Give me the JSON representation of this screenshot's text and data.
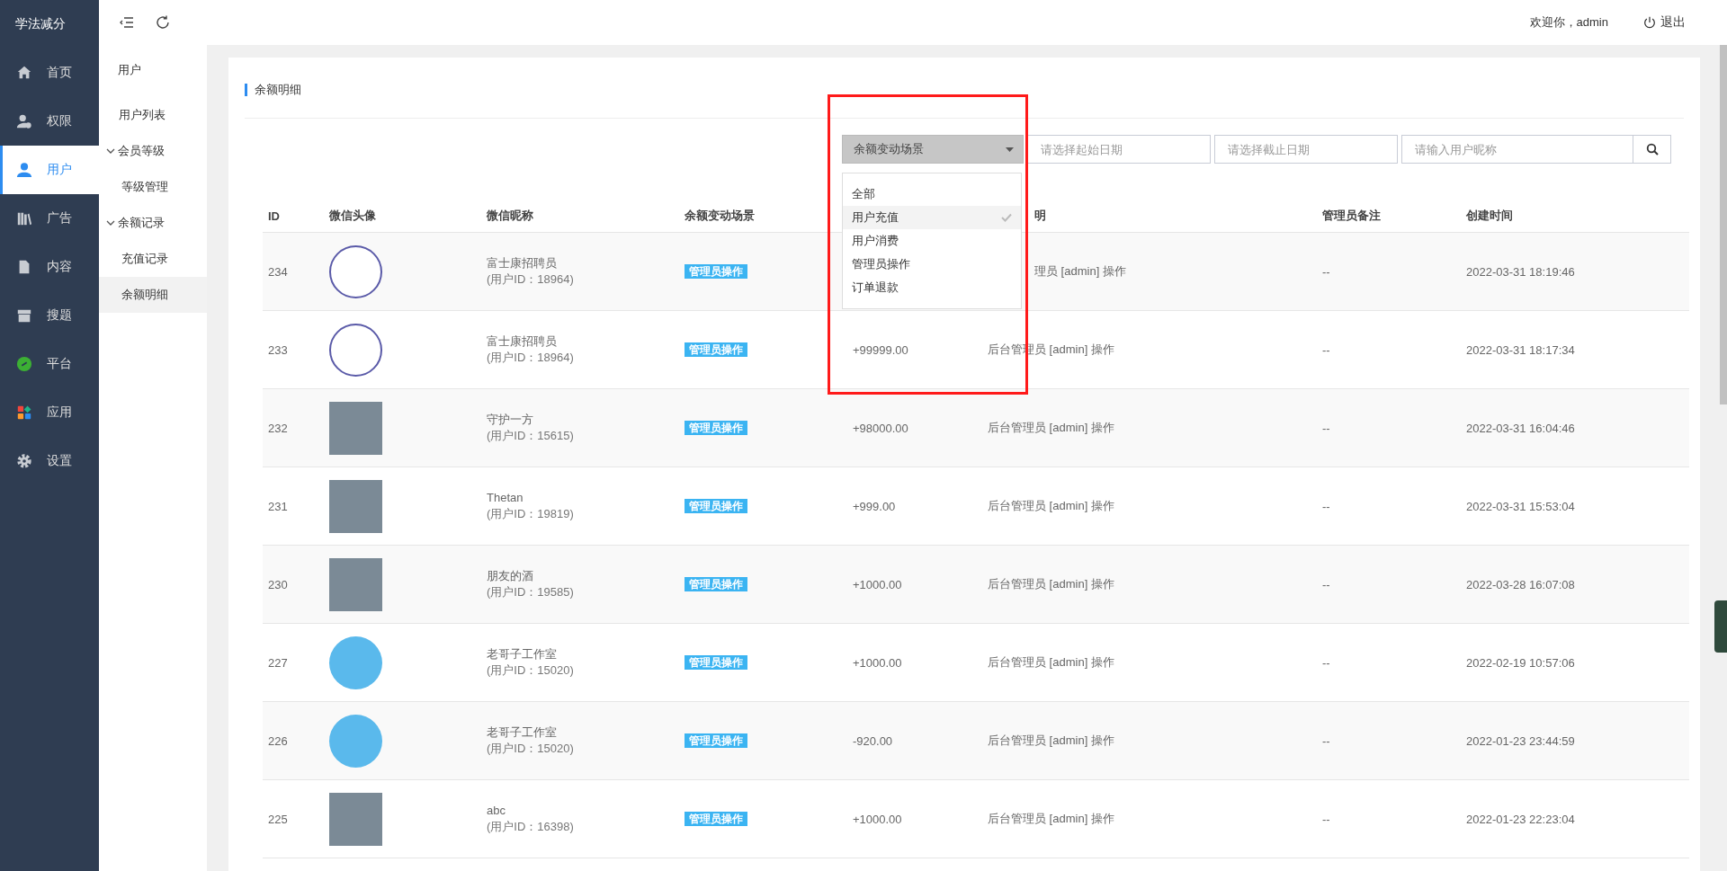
{
  "brand": "学法减分",
  "nav": [
    {
      "label": "首页",
      "selected": false
    },
    {
      "label": "权限",
      "selected": false
    },
    {
      "label": "用户",
      "selected": true
    },
    {
      "label": "广告",
      "selected": false
    },
    {
      "label": "内容",
      "selected": false
    },
    {
      "label": "搜题",
      "selected": false
    },
    {
      "label": "平台",
      "selected": false
    },
    {
      "label": "应用",
      "selected": false
    },
    {
      "label": "设置",
      "selected": false
    }
  ],
  "subnav": {
    "title": "用户",
    "items": [
      {
        "label": "用户列表",
        "selected": false
      },
      {
        "label": "会员等级",
        "expanded": true,
        "children": [
          {
            "label": "等级管理",
            "selected": false
          }
        ]
      },
      {
        "label": "余额记录",
        "expanded": true,
        "children": [
          {
            "label": "充值记录",
            "selected": false
          },
          {
            "label": "余额明细",
            "selected": true
          }
        ]
      }
    ]
  },
  "header": {
    "welcome": "欢迎你，admin",
    "logout": "退出"
  },
  "card_title": "余额明细",
  "filters": {
    "scene": "余额变动场景",
    "start_date": {
      "placeholder": "请选择起始日期"
    },
    "end_date": {
      "placeholder": "请选择截止日期"
    },
    "nickname": {
      "placeholder": "请输入用户昵称"
    }
  },
  "dropdown": {
    "open": true,
    "options": [
      {
        "label": "全部",
        "selected": false
      },
      {
        "label": "用户充值",
        "selected": true
      },
      {
        "label": "用户消费",
        "selected": false
      },
      {
        "label": "管理员操作",
        "selected": false
      },
      {
        "label": "订单退款",
        "selected": false
      }
    ]
  },
  "table": {
    "columns": [
      "ID",
      "微信头像",
      "微信昵称",
      "余额变动场景",
      "明",
      "管理员备注",
      "创建时间"
    ],
    "rows": [
      {
        "id": "234",
        "avatar": {
          "kind": "logo"
        },
        "nickname": "富士康招聘员",
        "user_id": "(用户ID：18964)",
        "scene": "管理员操作",
        "description": "理员 [admin] 操作",
        "note": "--",
        "time": "2022-03-31 18:19:46"
      },
      {
        "id": "233",
        "avatar": {
          "kind": "logo"
        },
        "nickname": "富士康招聘员",
        "user_id": "(用户ID：18964)",
        "scene": "管理员操作",
        "amount": "+99999.00",
        "description": "后台管理员 [admin] 操作",
        "note": "--",
        "time": "2022-03-31 18:17:34"
      },
      {
        "id": "232",
        "avatar": {
          "kind": "photo"
        },
        "nickname": "守护一方",
        "user_id": "(用户ID：15615)",
        "scene": "管理员操作",
        "amount": "+98000.00",
        "description": "后台管理员 [admin] 操作",
        "note": "--",
        "time": "2022-03-31 16:04:46"
      },
      {
        "id": "231",
        "avatar": {
          "kind": "photo"
        },
        "nickname": "Thetan",
        "user_id": "(用户ID：19819)",
        "scene": "管理员操作",
        "amount": "+999.00",
        "description": "后台管理员 [admin] 操作",
        "note": "--",
        "time": "2022-03-31 15:53:04"
      },
      {
        "id": "230",
        "avatar": {
          "kind": "photo"
        },
        "nickname": "朋友的酒",
        "user_id": "(用户ID：19585)",
        "scene": "管理员操作",
        "amount": "+1000.00",
        "description": "后台管理员 [admin] 操作",
        "note": "--",
        "time": "2022-03-28 16:07:08"
      },
      {
        "id": "227",
        "avatar": {
          "kind": "cartoon"
        },
        "nickname": "老哥子工作室",
        "user_id": "(用户ID：15020)",
        "scene": "管理员操作",
        "amount": "+1000.00",
        "description": "后台管理员 [admin] 操作",
        "note": "--",
        "time": "2022-02-19 10:57:06"
      },
      {
        "id": "226",
        "avatar": {
          "kind": "cartoon"
        },
        "nickname": "老哥子工作室",
        "user_id": "(用户ID：15020)",
        "scene": "管理员操作",
        "amount": "-920.00",
        "description": "后台管理员 [admin] 操作",
        "note": "--",
        "time": "2022-01-23 23:44:59"
      },
      {
        "id": "225",
        "avatar": {
          "kind": "photo"
        },
        "nickname": "abc",
        "user_id": "(用户ID：16398)",
        "scene": "管理员操作",
        "amount": "+1000.00",
        "description": "后台管理员 [admin] 操作",
        "note": "--",
        "time": "2022-01-23 22:23:04"
      }
    ]
  }
}
